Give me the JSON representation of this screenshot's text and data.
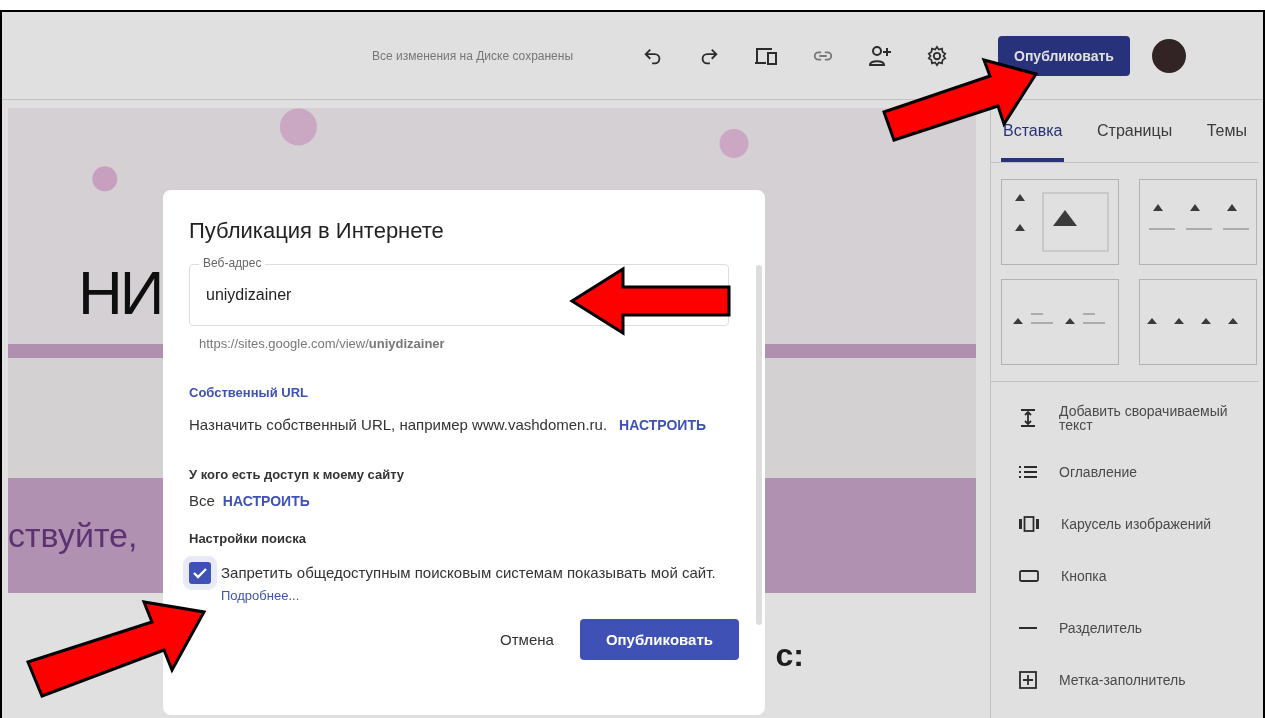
{
  "toolbar": {
    "save_status": "Все изменения на Диске сохранены",
    "publish_button": "Опубликовать"
  },
  "canvas": {
    "heading": "НИ",
    "greeting": "ствуйте,",
    "fragment": "с:"
  },
  "panel": {
    "tabs": [
      {
        "label": "Вставка",
        "selected": true
      },
      {
        "label": "Страницы",
        "selected": false
      },
      {
        "label": "Темы",
        "selected": false
      }
    ],
    "items": [
      {
        "kind": "collapse",
        "label": "Добавить сворачиваемый текст"
      },
      {
        "kind": "toc",
        "label": "Оглавление"
      },
      {
        "kind": "carousel",
        "label": "Карусель изображений"
      },
      {
        "kind": "button",
        "label": "Кнопка"
      },
      {
        "kind": "divider",
        "label": "Разделитель"
      },
      {
        "kind": "placeholder",
        "label": "Метка-заполнитель"
      }
    ]
  },
  "dialog": {
    "title": "Публикация в Интернете",
    "field": {
      "label": "Веб-адрес",
      "value": "uniydizainer"
    },
    "url": "https://sites.google.com/view/**uniydizainer**",
    "custom_url": {
      "heading": "Собственный URL",
      "text": "Назначить собственный URL, например www.vashdomen.ru.",
      "link": "НАСТРОИТЬ"
    },
    "access": {
      "heading": "У кого есть доступ к моему сайту",
      "value": "Все",
      "link": "НАСТРОИТЬ"
    },
    "search": {
      "heading": "Настройки поиска",
      "label": "Запретить общедоступным поисковым системам показывать мой сайт.",
      "checked": true,
      "link": "Подробнее..."
    },
    "cancel_button": "Отмена",
    "confirm_button": "Опубликовать"
  }
}
